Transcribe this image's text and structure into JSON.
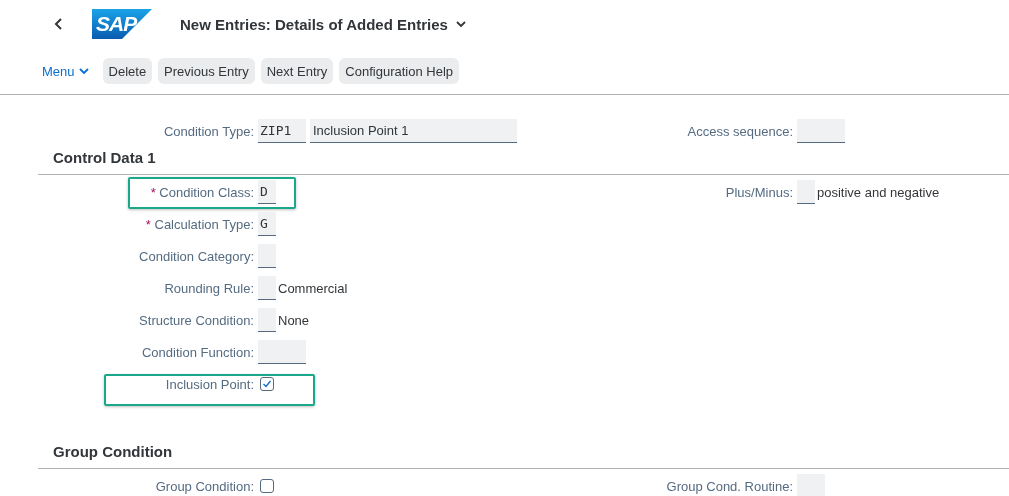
{
  "header": {
    "logo_text": "SAP",
    "title": "New Entries: Details of Added Entries"
  },
  "toolbar": {
    "menu": "Menu",
    "buttons": [
      "Delete",
      "Previous Entry",
      "Next Entry",
      "Configuration Help"
    ]
  },
  "top_row": {
    "left": {
      "label": "Condition Type:",
      "fields": [
        {
          "kind": "code",
          "value": "ZIP1"
        },
        {
          "kind": "name",
          "value": "Inclusion Point 1"
        }
      ]
    },
    "right": {
      "label": "Access sequence:",
      "fields": [
        {
          "kind": "code"
        }
      ]
    }
  },
  "sections": [
    {
      "title": "Control Data 1",
      "rows": [
        {
          "left": {
            "required_mark": "*",
            "label": "Condition Class:",
            "highlighted": true,
            "fields": [
              {
                "kind": "char",
                "value": "D"
              }
            ]
          },
          "right": {
            "label": "Plus/Minus:",
            "fields": [
              {
                "kind": "char",
                "description": "positive and negative"
              }
            ]
          }
        },
        {
          "left": {
            "required_mark": "*",
            "label": "Calculation Type:",
            "fields": [
              {
                "kind": "char",
                "value": "G"
              }
            ]
          }
        },
        {
          "left": {
            "label": "Condition Category:",
            "fields": [
              {
                "kind": "char"
              }
            ]
          }
        },
        {
          "left": {
            "label": "Rounding Rule:",
            "fields": [
              {
                "kind": "char",
                "description": "Commercial"
              }
            ]
          }
        },
        {
          "left": {
            "label": "Structure Condition:",
            "fields": [
              {
                "kind": "char",
                "description": "None"
              }
            ]
          }
        },
        {
          "left": {
            "label": "Condition Function:",
            "fields": [
              {
                "kind": "code"
              }
            ]
          }
        },
        {
          "left": {
            "label": "Inclusion Point:",
            "highlighted": true,
            "fields": [
              {
                "kind": "checkbox",
                "checked": true
              }
            ]
          }
        }
      ]
    },
    {
      "title": "Group Condition",
      "rows": [
        {
          "left": {
            "label": "Group Condition:",
            "fields": [
              {
                "kind": "checkbox",
                "checked": false
              }
            ]
          },
          "right": {
            "label": "Group Cond. Routine:",
            "fields": [
              {
                "kind": "short"
              }
            ]
          }
        }
      ]
    }
  ]
}
